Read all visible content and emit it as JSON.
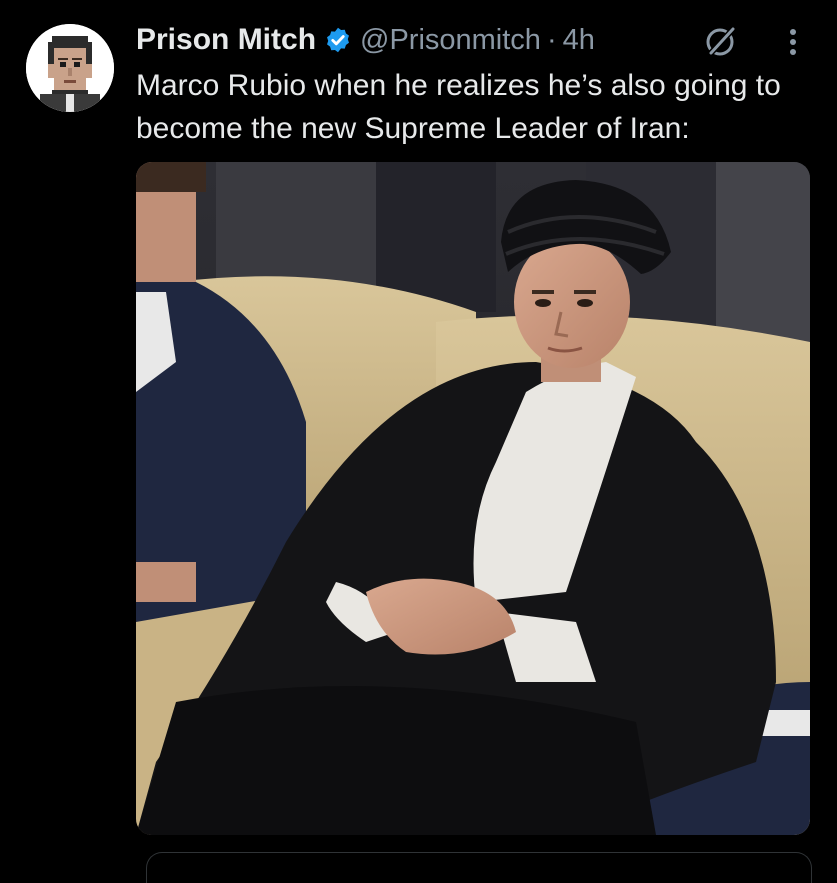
{
  "post": {
    "author": {
      "display_name": "Prison Mitch",
      "handle": "@Prisonmitch",
      "verified": true,
      "avatar_icon": "pixel-art-face-avatar"
    },
    "separator": "·",
    "time_ago": "4h",
    "text": "Marco Rubio when he realizes he’s also going to become the new Supreme Leader of Iran:",
    "icons": {
      "verified": "verified-badge-icon",
      "grok": "grok-icon",
      "more": "more-options-icon"
    },
    "media": {
      "type": "photo",
      "subject": "man in black turban and robe seated on a gold sofa"
    }
  },
  "colors": {
    "background": "#000000",
    "text_primary": "#e7e9ea",
    "text_secondary": "#8b98a5",
    "verified_blue": "#1d9bf0",
    "border": "#2f3336"
  }
}
